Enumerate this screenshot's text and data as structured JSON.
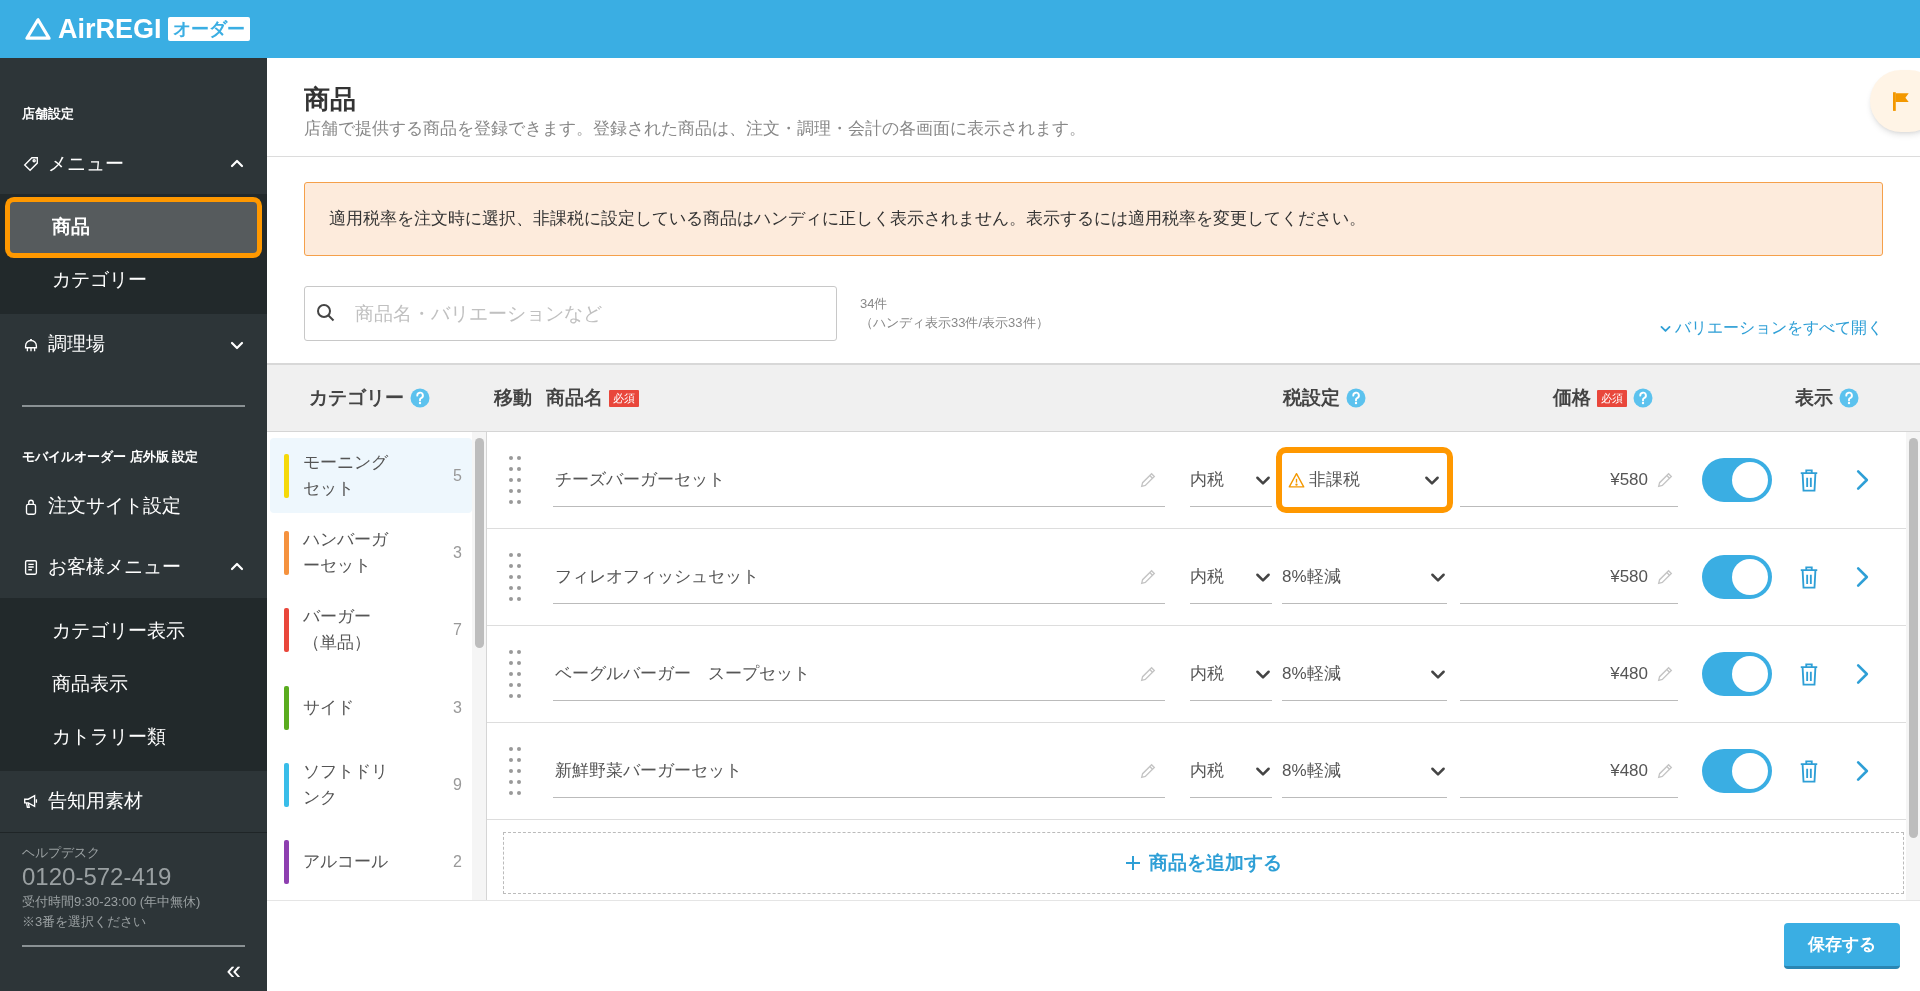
{
  "header": {
    "logo_text": "AirREGI",
    "logo_badge": "オーダー"
  },
  "sidebar": {
    "sections": [
      {
        "title": "店舗設定",
        "items": [
          {
            "label": "メニュー",
            "expanded": true,
            "children": [
              {
                "label": "商品",
                "selected": true,
                "highlighted": true
              },
              {
                "label": "カテゴリー",
                "selected": false,
                "highlighted": false
              }
            ]
          },
          {
            "label": "調理場",
            "expanded": false
          }
        ]
      },
      {
        "title": "モバイルオーダー 店外版 設定",
        "items": [
          {
            "label": "注文サイト設定"
          },
          {
            "label": "お客様メニュー",
            "expanded": true,
            "children": [
              {
                "label": "カテゴリー表示",
                "selected": false,
                "highlighted": false
              },
              {
                "label": "商品表示",
                "selected": false,
                "highlighted": false
              },
              {
                "label": "カトラリー類",
                "selected": false,
                "highlighted": false
              }
            ]
          },
          {
            "label": "告知用素材"
          }
        ]
      }
    ],
    "help": {
      "label": "ヘルプデスク",
      "phone": "0120-572-419",
      "hours": "受付時間9:30-23:00 (年中無休)",
      "note": "※3番を選択ください",
      "collapse": "«"
    }
  },
  "page": {
    "title": "商品",
    "subtitle": "店舗で提供する商品を登録できます。登録された商品は、注文・調理・会計の各画面に表示されます。",
    "alert": "適用税率を注文時に選択、非課税に設定している商品はハンディに正しく表示されません。表示するには適用税率を変更してください。",
    "search_placeholder": "商品名・バリエーションなど",
    "count": "34件",
    "count_detail": "（ハンディ表示33件/表示33件）",
    "expand_link": "バリエーションをすべて開く"
  },
  "columns": {
    "category": "カテゴリー",
    "move": "移動",
    "name": "商品名",
    "name_required": "必須",
    "tax": "税設定",
    "price": "価格",
    "price_required": "必須",
    "display": "表示"
  },
  "categories": [
    {
      "name": "モーニングセット",
      "count": "5",
      "color": "#f5d90a",
      "selected": true
    },
    {
      "name": "ハンバーガーセット",
      "count": "3",
      "color": "#f5923e",
      "selected": false
    },
    {
      "name": "バーガー（単品）",
      "count": "7",
      "color": "#e9473b",
      "selected": false
    },
    {
      "name": "サイド",
      "count": "3",
      "color": "#5aac1f",
      "selected": false
    },
    {
      "name": "ソフトドリンク",
      "count": "9",
      "color": "#39bde9",
      "selected": false
    },
    {
      "name": "アルコール",
      "count": "2",
      "color": "#8e3fb0",
      "selected": false
    }
  ],
  "products": [
    {
      "name": "チーズバーガーセット",
      "tax_type": "内税",
      "rate": "非課税",
      "warning": true,
      "highlighted": true,
      "price": "¥580",
      "on": true,
      "faded": false
    },
    {
      "name": "フィレオフィッシュセット",
      "tax_type": "内税",
      "rate": "8%軽減",
      "warning": false,
      "highlighted": false,
      "price": "¥580",
      "on": true,
      "faded": false
    },
    {
      "name": "ベーグルバーガー　スープセット",
      "tax_type": "内税",
      "rate": "8%軽減",
      "warning": false,
      "highlighted": false,
      "price": "¥480",
      "on": true,
      "faded": false
    },
    {
      "name": "新鮮野菜バーガーセット",
      "tax_type": "内税",
      "rate": "8%軽減",
      "warning": false,
      "highlighted": false,
      "price": "¥480",
      "on": true,
      "faded": false
    }
  ],
  "add_label": "商品を追加する",
  "save": "保存する"
}
